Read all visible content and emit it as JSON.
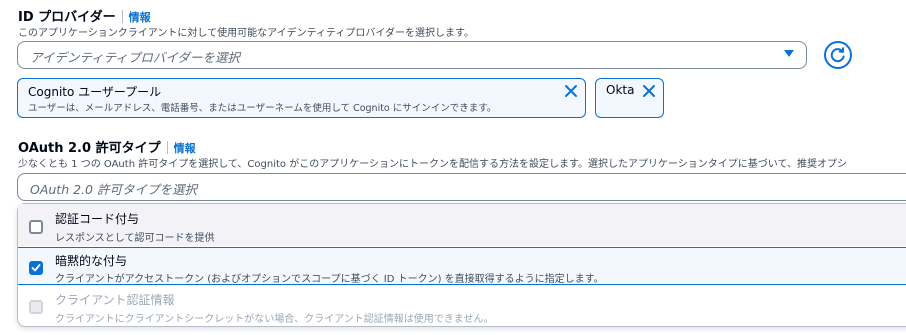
{
  "identity_providers": {
    "label": "ID プロバイダー",
    "info": "情報",
    "description": "このアプリケーションクライアントに対して使用可能なアイデンティティプロバイダーを選択します。",
    "placeholder": "アイデンティティプロバイダーを選択",
    "selected": [
      {
        "title": "Cognito ユーザープール",
        "description": "ユーザーは、メールアドレス、電話番号、またはユーザーネームを使用して Cognito にサインインできます。"
      },
      {
        "title": "Okta",
        "description": ""
      }
    ]
  },
  "oauth_grant_types": {
    "label": "OAuth 2.0 許可タイプ",
    "info": "情報",
    "description": "少なくとも 1 つの OAuth 許可タイプを選択して、Cognito がこのアプリケーションにトークンを配信する方法を設定します。選択したアプリケーションタイプに基づいて、推奨オプシ",
    "placeholder": "OAuth 2.0 許可タイプを選択",
    "options": [
      {
        "title": "認証コード付与",
        "description": "レスポンスとして認可コードを提供",
        "checked": false,
        "disabled": false
      },
      {
        "title": "暗黙的な付与",
        "description": "クライアントがアクセストークン (およびオプションでスコープに基づく ID トークン) を直接取得するように指定します。",
        "checked": true,
        "disabled": false
      },
      {
        "title": "クライアント認証情報",
        "description": "クライアントにクライアントシークレットがない場合、クライアント認証情報は使用できません。",
        "checked": false,
        "disabled": true
      }
    ]
  },
  "colors": {
    "accent": "#0972d3",
    "text": "#000716",
    "muted": "#414d5c",
    "disabled": "#9ba7b6"
  }
}
